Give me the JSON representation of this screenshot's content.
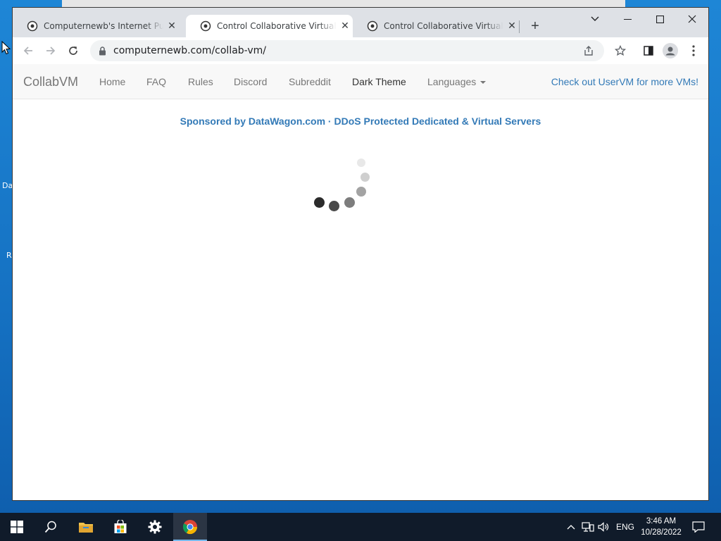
{
  "desktop": {
    "left_labels": [
      "Da",
      "R"
    ]
  },
  "browser": {
    "tabs": [
      {
        "title": "Computernewb's Internet Pub H",
        "active": false
      },
      {
        "title": "Control Collaborative Virtual Ma",
        "active": true
      },
      {
        "title": "Control Collaborative Virtual Ma",
        "active": false
      }
    ],
    "tab_close_glyph": "✕",
    "new_tab_glyph": "+",
    "url": "computernewb.com/collab-vm/"
  },
  "site": {
    "brand": "CollabVM",
    "nav": [
      "Home",
      "FAQ",
      "Rules",
      "Discord",
      "Subreddit"
    ],
    "dark_theme": "Dark Theme",
    "languages": "Languages",
    "uservm_link": "Check out UserVM for more VMs!",
    "sponsor": "Sponsored by DataWagon.com · DDoS Protected Dedicated & Virtual Servers"
  },
  "taskbar": {
    "language": "ENG",
    "time": "3:46 AM",
    "date": "10/28/2022"
  },
  "colors": {
    "link": "#337ab7",
    "nav_text": "#777777",
    "taskbar": "#101b2a",
    "desktop": "#1e86d6"
  }
}
